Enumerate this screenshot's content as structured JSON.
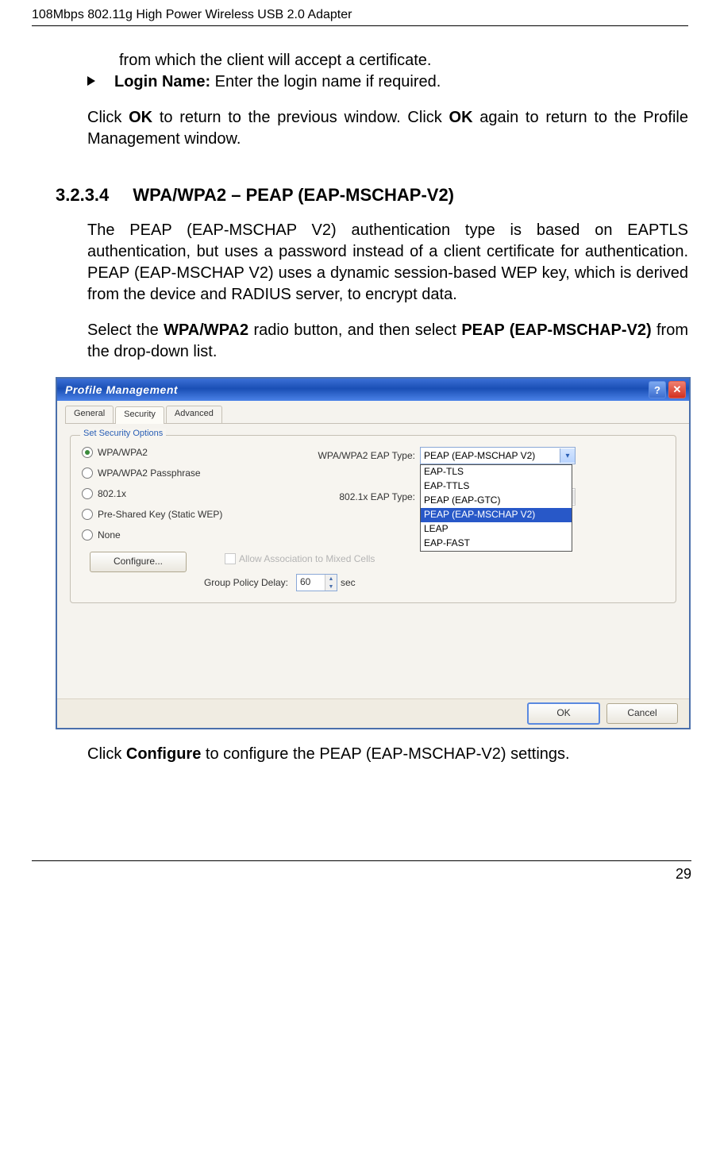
{
  "header": "108Mbps 802.11g High Power Wireless USB 2.0 Adapter",
  "cont_text_from": "from which the client will accept a certificate.",
  "bullet": {
    "label": "Login Name:",
    "text": " Enter the login name if required."
  },
  "para_ok": {
    "pre": "Click ",
    "b1": "OK",
    "mid": " to return to the previous window. Click ",
    "b2": "OK",
    "post": " again to return to the Profile Management window."
  },
  "section": {
    "num": "3.2.3.4",
    "title": "WPA/WPA2 – PEAP (EAP-MSCHAP-V2)"
  },
  "para_desc": "The PEAP (EAP-MSCHAP V2) authentication type is based on EAPTLS authentication, but uses a password instead of a client certificate for authentication. PEAP (EAP-MSCHAP V2) uses a dynamic session-based WEP key, which is derived from the device and RADIUS server, to encrypt data.",
  "para_select": {
    "pre": "Select the ",
    "b1": "WPA/WPA2",
    "mid": " radio button, and then select ",
    "b2": "PEAP (EAP-MSCHAP-V2)",
    "post": " from the drop-down list."
  },
  "dialog": {
    "title": "Profile Management",
    "tabs": [
      "General",
      "Security",
      "Advanced"
    ],
    "groupbox_title": "Set Security Options",
    "radios": [
      "WPA/WPA2",
      "WPA/WPA2 Passphrase",
      "802.1x",
      "Pre-Shared Key (Static WEP)",
      "None"
    ],
    "eap_label": "WPA/WPA2 EAP Type:",
    "eap_value": "PEAP (EAP-MSCHAP V2)",
    "eap_list": [
      "EAP-TLS",
      "EAP-TTLS",
      "PEAP (EAP-GTC)",
      "PEAP (EAP-MSCHAP V2)",
      "LEAP",
      "EAP-FAST"
    ],
    "eap2_label": "802.1x EAP Type:",
    "configure": "Configure...",
    "assoc": "Allow Association to Mixed Cells",
    "gpd_label": "Group Policy Delay:",
    "gpd_value": "60",
    "gpd_unit": "sec",
    "ok": "OK",
    "cancel": "Cancel"
  },
  "para_configure": {
    "pre": "Click ",
    "b1": "Configure",
    "post": " to configure the PEAP (EAP-MSCHAP-V2) settings."
  },
  "page_number": "29"
}
